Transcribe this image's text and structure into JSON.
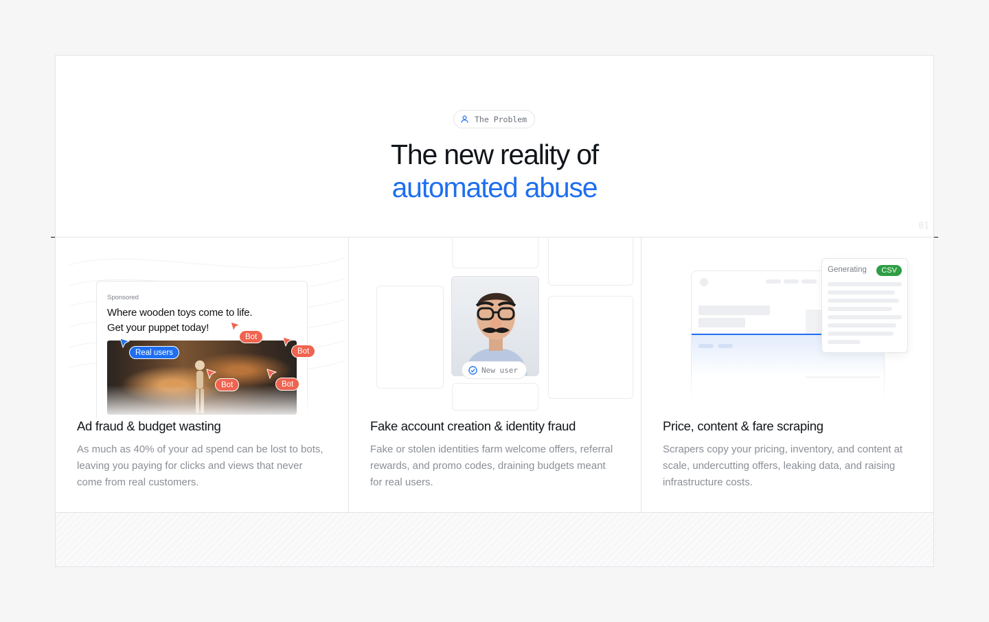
{
  "hero": {
    "pill_label": "The Problem",
    "title_line1": "The new reality of",
    "title_line2": "automated abuse",
    "section_number": "01"
  },
  "cards": [
    {
      "title": "Ad fraud & budget wasting",
      "description": "As much as 40% of your ad spend can be lost to bots, leaving you paying for clicks and views that never come from real customers.",
      "illustration": {
        "sponsored": "Sponsored",
        "headline_line1": "Where wooden toys come to life.",
        "headline_line2": "Get your puppet today!",
        "real_tag": "Real users",
        "bot_tag": "Bot"
      }
    },
    {
      "title": "Fake account creation & identity fraud",
      "description": "Fake or stolen identities farm welcome offers, referral rewards, and promo codes, draining budgets meant for real users.",
      "illustration": {
        "badge": "New user"
      }
    },
    {
      "title": "Price, content & fare scraping",
      "description": "Scrapers copy your pricing, inventory, and content at scale, undercutting offers, leaking data, and raising infrastructure costs.",
      "illustration": {
        "status": "Generating",
        "format": "CSV"
      }
    }
  ],
  "colors": {
    "accent": "#1e6ff0",
    "bot": "#f0634f",
    "success": "#2f9e44",
    "text": "#111418",
    "muted": "#8a8e95"
  }
}
